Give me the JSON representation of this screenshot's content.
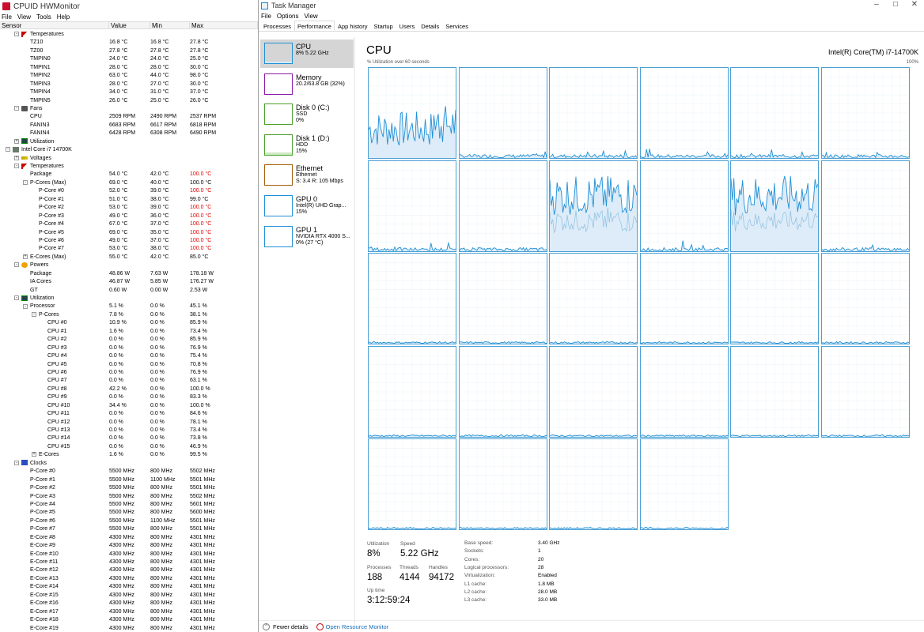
{
  "hwmonitor": {
    "title": "CPUID HWMonitor",
    "menu": [
      "File",
      "View",
      "Tools",
      "Help"
    ],
    "columns": {
      "sensor": "Sensor",
      "value": "Value",
      "min": "Min",
      "max": "Max"
    },
    "rows": [
      {
        "d": 2,
        "g": "thermo",
        "name": "Temperatures",
        "e": "-"
      },
      {
        "d": 3,
        "name": "TZ10",
        "v": "16.8 °C",
        "mn": "16.8 °C",
        "mx": "27.8 °C"
      },
      {
        "d": 3,
        "name": "TZ00",
        "v": "27.8 °C",
        "mn": "27.8 °C",
        "mx": "27.8 °C"
      },
      {
        "d": 3,
        "name": "TMPIN0",
        "v": "24.0 °C",
        "mn": "24.0 °C",
        "mx": "25.0 °C"
      },
      {
        "d": 3,
        "name": "TMPIN1",
        "v": "28.0 °C",
        "mn": "28.0 °C",
        "mx": "30.0 °C"
      },
      {
        "d": 3,
        "name": "TMPIN2",
        "v": "63.0 °C",
        "mn": "44.0 °C",
        "mx": "98.0 °C"
      },
      {
        "d": 3,
        "name": "TMPIN3",
        "v": "28.0 °C",
        "mn": "27.0 °C",
        "mx": "30.0 °C"
      },
      {
        "d": 3,
        "name": "TMPIN4",
        "v": "34.0 °C",
        "mn": "31.0 °C",
        "mx": "37.0 °C"
      },
      {
        "d": 3,
        "name": "TMPIN5",
        "v": "26.0 °C",
        "mn": "25.0 °C",
        "mx": "26.0 °C"
      },
      {
        "d": 2,
        "g": "fan",
        "name": "Fans",
        "e": "-"
      },
      {
        "d": 3,
        "name": "CPU",
        "v": "2509 RPM",
        "mn": "2490 RPM",
        "mx": "2537 RPM"
      },
      {
        "d": 3,
        "name": "FANIN3",
        "v": "6683 RPM",
        "mn": "6617 RPM",
        "mx": "6818 RPM"
      },
      {
        "d": 3,
        "name": "FANIN4",
        "v": "6428 RPM",
        "mn": "6308 RPM",
        "mx": "6490 RPM"
      },
      {
        "d": 2,
        "g": "util",
        "name": "Utilization",
        "e": "+"
      },
      {
        "d": 1,
        "g": "cpu",
        "name": "Intel Core i7 14700K",
        "e": "-"
      },
      {
        "d": 2,
        "g": "volt",
        "name": "Voltages",
        "e": "+"
      },
      {
        "d": 2,
        "g": "thermo",
        "name": "Temperatures",
        "e": "-"
      },
      {
        "d": 3,
        "name": "Package",
        "v": "54.0 °C",
        "mn": "42.0 °C",
        "mx": "100.0 °C",
        "r": true
      },
      {
        "d": 3,
        "name": "P-Cores (Max)",
        "v": "69.0 °C",
        "mn": "40.0 °C",
        "mx": "100.0 °C",
        "e": "-"
      },
      {
        "d": 4,
        "name": "P-Core #0",
        "v": "52.0 °C",
        "mn": "39.0 °C",
        "mx": "100.0 °C",
        "r": true
      },
      {
        "d": 4,
        "name": "P-Core #1",
        "v": "51.0 °C",
        "mn": "38.0 °C",
        "mx": "99.0 °C"
      },
      {
        "d": 4,
        "name": "P-Core #2",
        "v": "53.0 °C",
        "mn": "39.0 °C",
        "mx": "100.0 °C",
        "r": true
      },
      {
        "d": 4,
        "name": "P-Core #3",
        "v": "49.0 °C",
        "mn": "36.0 °C",
        "mx": "100.0 °C",
        "r": true
      },
      {
        "d": 4,
        "name": "P-Core #4",
        "v": "67.0 °C",
        "mn": "37.0 °C",
        "mx": "100.0 °C",
        "r": true
      },
      {
        "d": 4,
        "name": "P-Core #5",
        "v": "69.0 °C",
        "mn": "35.0 °C",
        "mx": "100.0 °C",
        "r": true
      },
      {
        "d": 4,
        "name": "P-Core #6",
        "v": "49.0 °C",
        "mn": "37.0 °C",
        "mx": "100.0 °C",
        "r": true
      },
      {
        "d": 4,
        "name": "P-Core #7",
        "v": "53.0 °C",
        "mn": "38.0 °C",
        "mx": "100.0 °C",
        "r": true
      },
      {
        "d": 3,
        "name": "E-Cores (Max)",
        "v": "55.0 °C",
        "mn": "42.0 °C",
        "mx": "85.0 °C",
        "e": "+"
      },
      {
        "d": 2,
        "g": "power",
        "name": "Powers",
        "e": "-"
      },
      {
        "d": 3,
        "name": "Package",
        "v": "48.86 W",
        "mn": "7.63 W",
        "mx": "178.18 W"
      },
      {
        "d": 3,
        "name": "IA Cores",
        "v": "46.87 W",
        "mn": "5.85 W",
        "mx": "176.27 W"
      },
      {
        "d": 3,
        "name": "GT",
        "v": "0.60 W",
        "mn": "0.00 W",
        "mx": "2.53 W"
      },
      {
        "d": 2,
        "g": "util",
        "name": "Utilization",
        "e": "-"
      },
      {
        "d": 3,
        "name": "Processor",
        "v": "5.1 %",
        "mn": "0.0 %",
        "mx": "45.1 %",
        "e": "-"
      },
      {
        "d": 4,
        "name": "P-Cores",
        "v": "7.8 %",
        "mn": "0.0 %",
        "mx": "38.1 %",
        "e": "-"
      },
      {
        "d": 5,
        "name": "CPU #0",
        "v": "10.9 %",
        "mn": "0.0 %",
        "mx": "85.9 %"
      },
      {
        "d": 5,
        "name": "CPU #1",
        "v": "1.6 %",
        "mn": "0.0 %",
        "mx": "73.4 %"
      },
      {
        "d": 5,
        "name": "CPU #2",
        "v": "0.0 %",
        "mn": "0.0 %",
        "mx": "85.9 %"
      },
      {
        "d": 5,
        "name": "CPU #3",
        "v": "0.0 %",
        "mn": "0.0 %",
        "mx": "76.9 %"
      },
      {
        "d": 5,
        "name": "CPU #4",
        "v": "0.0 %",
        "mn": "0.0 %",
        "mx": "75.4 %"
      },
      {
        "d": 5,
        "name": "CPU #5",
        "v": "0.0 %",
        "mn": "0.0 %",
        "mx": "70.8 %"
      },
      {
        "d": 5,
        "name": "CPU #6",
        "v": "0.0 %",
        "mn": "0.0 %",
        "mx": "76.9 %"
      },
      {
        "d": 5,
        "name": "CPU #7",
        "v": "0.0 %",
        "mn": "0.0 %",
        "mx": "63.1 %"
      },
      {
        "d": 5,
        "name": "CPU #8",
        "v": "42.2 %",
        "mn": "0.0 %",
        "mx": "100.0 %"
      },
      {
        "d": 5,
        "name": "CPU #9",
        "v": "0.0 %",
        "mn": "0.0 %",
        "mx": "83.3 %"
      },
      {
        "d": 5,
        "name": "CPU #10",
        "v": "34.4 %",
        "mn": "0.0 %",
        "mx": "100.0 %"
      },
      {
        "d": 5,
        "name": "CPU #11",
        "v": "0.0 %",
        "mn": "0.0 %",
        "mx": "84.6 %"
      },
      {
        "d": 5,
        "name": "CPU #12",
        "v": "0.0 %",
        "mn": "0.0 %",
        "mx": "78.1 %"
      },
      {
        "d": 5,
        "name": "CPU #13",
        "v": "0.0 %",
        "mn": "0.0 %",
        "mx": "73.4 %"
      },
      {
        "d": 5,
        "name": "CPU #14",
        "v": "0.0 %",
        "mn": "0.0 %",
        "mx": "73.8 %"
      },
      {
        "d": 5,
        "name": "CPU #15",
        "v": "0.0 %",
        "mn": "0.0 %",
        "mx": "46.9 %"
      },
      {
        "d": 4,
        "name": "E-Cores",
        "v": "1.6 %",
        "mn": "0.0 %",
        "mx": "99.5 %",
        "e": "+"
      },
      {
        "d": 2,
        "g": "clock",
        "name": "Clocks",
        "e": "-"
      },
      {
        "d": 3,
        "name": "P-Core #0",
        "v": "5500 MHz",
        "mn": "800 MHz",
        "mx": "5502 MHz"
      },
      {
        "d": 3,
        "name": "P-Core #1",
        "v": "5500 MHz",
        "mn": "1100 MHz",
        "mx": "5501 MHz"
      },
      {
        "d": 3,
        "name": "P-Core #2",
        "v": "5500 MHz",
        "mn": "800 MHz",
        "mx": "5501 MHz"
      },
      {
        "d": 3,
        "name": "P-Core #3",
        "v": "5500 MHz",
        "mn": "800 MHz",
        "mx": "5502 MHz"
      },
      {
        "d": 3,
        "name": "P-Core #4",
        "v": "5500 MHz",
        "mn": "800 MHz",
        "mx": "5601 MHz"
      },
      {
        "d": 3,
        "name": "P-Core #5",
        "v": "5500 MHz",
        "mn": "800 MHz",
        "mx": "5600 MHz"
      },
      {
        "d": 3,
        "name": "P-Core #6",
        "v": "5500 MHz",
        "mn": "1100 MHz",
        "mx": "5501 MHz"
      },
      {
        "d": 3,
        "name": "P-Core #7",
        "v": "5500 MHz",
        "mn": "800 MHz",
        "mx": "5501 MHz"
      },
      {
        "d": 3,
        "name": "E-Core #8",
        "v": "4300 MHz",
        "mn": "800 MHz",
        "mx": "4301 MHz"
      },
      {
        "d": 3,
        "name": "E-Core #9",
        "v": "4300 MHz",
        "mn": "800 MHz",
        "mx": "4301 MHz"
      },
      {
        "d": 3,
        "name": "E-Core #10",
        "v": "4300 MHz",
        "mn": "800 MHz",
        "mx": "4301 MHz"
      },
      {
        "d": 3,
        "name": "E-Core #11",
        "v": "4300 MHz",
        "mn": "800 MHz",
        "mx": "4301 MHz"
      },
      {
        "d": 3,
        "name": "E-Core #12",
        "v": "4300 MHz",
        "mn": "800 MHz",
        "mx": "4301 MHz"
      },
      {
        "d": 3,
        "name": "E-Core #13",
        "v": "4300 MHz",
        "mn": "800 MHz",
        "mx": "4301 MHz"
      },
      {
        "d": 3,
        "name": "E-Core #14",
        "v": "4300 MHz",
        "mn": "800 MHz",
        "mx": "4301 MHz"
      },
      {
        "d": 3,
        "name": "E-Core #15",
        "v": "4300 MHz",
        "mn": "800 MHz",
        "mx": "4301 MHz"
      },
      {
        "d": 3,
        "name": "E-Core #16",
        "v": "4300 MHz",
        "mn": "800 MHz",
        "mx": "4301 MHz"
      },
      {
        "d": 3,
        "name": "E-Core #17",
        "v": "4300 MHz",
        "mn": "800 MHz",
        "mx": "4301 MHz"
      },
      {
        "d": 3,
        "name": "E-Core #18",
        "v": "4300 MHz",
        "mn": "800 MHz",
        "mx": "4301 MHz"
      },
      {
        "d": 3,
        "name": "E-Core #19",
        "v": "4300 MHz",
        "mn": "800 MHz",
        "mx": "4301 MHz"
      }
    ]
  },
  "taskmanager": {
    "title": "Task Manager",
    "menu": [
      "File",
      "Options",
      "View"
    ],
    "tabs": [
      "Processes",
      "Performance",
      "App history",
      "Startup",
      "Users",
      "Details",
      "Services"
    ],
    "active_tab": "Performance",
    "sidebar": [
      {
        "title": "CPU",
        "l1": "8% 5.22 GHz",
        "l2": "",
        "l3": "",
        "color": "#1f8fd6",
        "selected": true
      },
      {
        "title": "Memory",
        "l1": "20.2/63.8 GB (32%)",
        "l2": "",
        "l3": "",
        "color": "#8b1aa8"
      },
      {
        "title": "Disk 0 (C:)",
        "l1": "SSD",
        "l2": "0%",
        "l3": "",
        "color": "#4aa02c"
      },
      {
        "title": "Disk 1 (D:)",
        "l1": "HDD",
        "l2": "15%",
        "l3": "",
        "color": "#4aa02c"
      },
      {
        "title": "Ethernet",
        "l1": "Ethernet",
        "l2": "S: 3.4  R: 105 Mbps",
        "l3": "",
        "color": "#a65c0a"
      },
      {
        "title": "GPU 0",
        "l1": "Intel(R) UHD Grap...",
        "l2": "15%",
        "l3": "",
        "color": "#1f8fd6"
      },
      {
        "title": "GPU 1",
        "l1": "NVIDIA RTX 4000 S...",
        "l2": "0% (27 °C)",
        "l3": "",
        "color": "#1f8fd6"
      }
    ],
    "cpu": {
      "title": "CPU",
      "model": "Intel(R) Core(TM) i7-14700K",
      "util_label": "% Utilization over 60 seconds",
      "util_max": "100%",
      "stats": {
        "utilization_label": "Utilization",
        "utilization": "8%",
        "speed_label": "Speed",
        "speed": "5.22 GHz",
        "processes_label": "Processes",
        "processes": "188",
        "threads_label": "Threads",
        "threads": "4144",
        "handles_label": "Handles",
        "handles": "94172",
        "uptime_label": "Up time",
        "uptime": "3:12:59:24"
      },
      "specs": [
        {
          "k": "Base speed:",
          "v": "3.40 GHz"
        },
        {
          "k": "Sockets:",
          "v": "1"
        },
        {
          "k": "Cores:",
          "v": "20"
        },
        {
          "k": "Logical processors:",
          "v": "28"
        },
        {
          "k": "Virtualization:",
          "v": "Enabled"
        },
        {
          "k": "L1 cache:",
          "v": "1.8 MB"
        },
        {
          "k": "L2 cache:",
          "v": "28.0 MB"
        },
        {
          "k": "L3 cache:",
          "v": "33.0 MB"
        }
      ],
      "graph_color": "#1f8fd6",
      "core_activity": [
        "medium-high",
        "low",
        "low",
        "low",
        "low",
        "low",
        "low",
        "low",
        "high",
        "low",
        "high",
        "low",
        "idle",
        "idle",
        "idle",
        "idle",
        "idle",
        "idle",
        "idle",
        "idle",
        "idle",
        "idle",
        "idle",
        "idle",
        "idle",
        "idle",
        "idle",
        "idle"
      ]
    },
    "footer": {
      "fewer_details": "Fewer details",
      "open_rm": "Open Resource Monitor"
    },
    "window_buttons": {
      "min": "–",
      "max": "□",
      "close": "✕"
    }
  }
}
